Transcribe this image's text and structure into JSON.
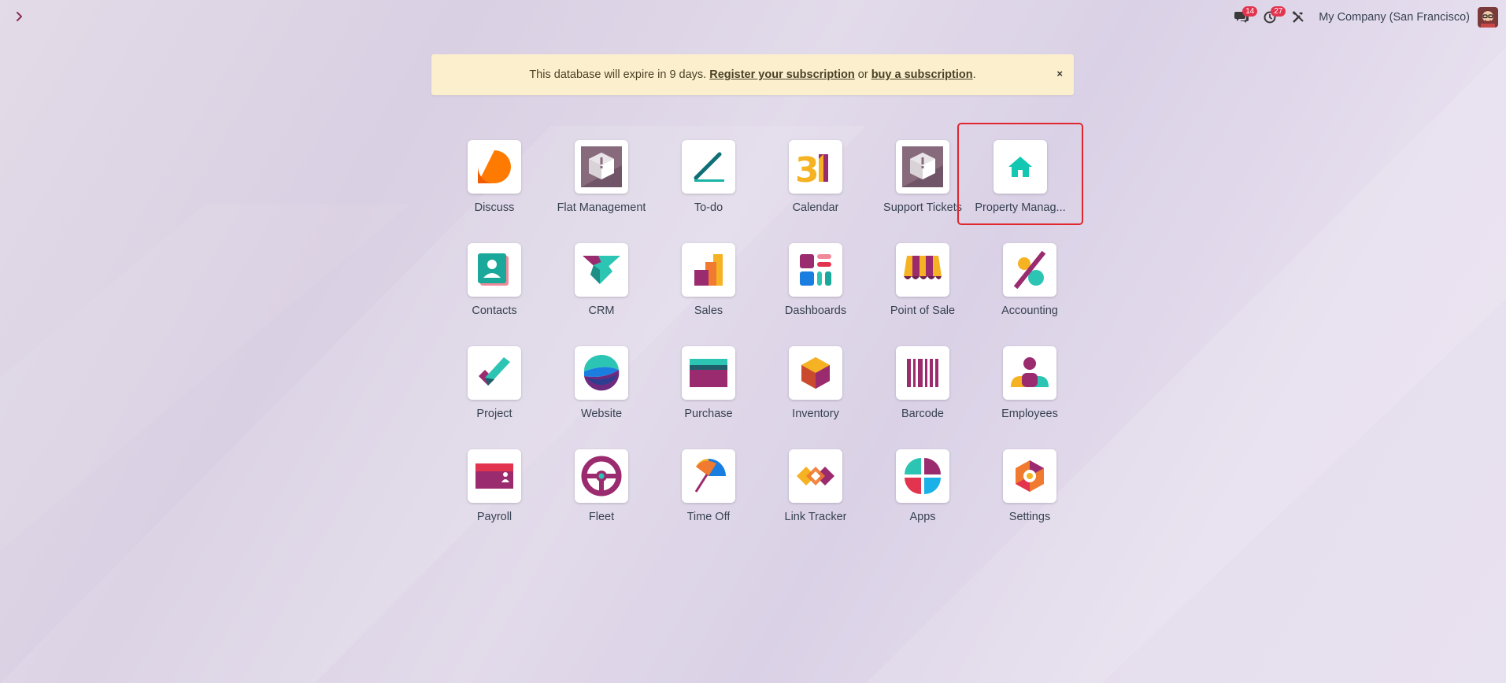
{
  "topbar": {
    "messages_badge": "14",
    "activities_badge": "27",
    "company_name": "My Company (San Francisco)"
  },
  "banner": {
    "text_before": "This database will expire in 9 days. ",
    "register_link": "Register your subscription",
    "text_middle": " or ",
    "buy_link": "buy a subscription",
    "text_after": ".",
    "close_label": "×"
  },
  "apps": [
    {
      "label": "Discuss",
      "icon": "discuss-icon"
    },
    {
      "label": "Flat Management",
      "icon": "flat-management-icon"
    },
    {
      "label": "To-do",
      "icon": "todo-icon"
    },
    {
      "label": "Calendar",
      "icon": "calendar-icon"
    },
    {
      "label": "Support Tickets",
      "icon": "support-tickets-icon"
    },
    {
      "label": "Property Manag...",
      "icon": "property-management-icon"
    },
    {
      "label": "Contacts",
      "icon": "contacts-icon"
    },
    {
      "label": "CRM",
      "icon": "crm-icon"
    },
    {
      "label": "Sales",
      "icon": "sales-icon"
    },
    {
      "label": "Dashboards",
      "icon": "dashboards-icon"
    },
    {
      "label": "Point of Sale",
      "icon": "point-of-sale-icon"
    },
    {
      "label": "Accounting",
      "icon": "accounting-icon"
    },
    {
      "label": "Project",
      "icon": "project-icon"
    },
    {
      "label": "Website",
      "icon": "website-icon"
    },
    {
      "label": "Purchase",
      "icon": "purchase-icon"
    },
    {
      "label": "Inventory",
      "icon": "inventory-icon"
    },
    {
      "label": "Barcode",
      "icon": "barcode-icon"
    },
    {
      "label": "Employees",
      "icon": "employees-icon"
    },
    {
      "label": "Payroll",
      "icon": "payroll-icon"
    },
    {
      "label": "Fleet",
      "icon": "fleet-icon"
    },
    {
      "label": "Time Off",
      "icon": "time-off-icon"
    },
    {
      "label": "Link Tracker",
      "icon": "link-tracker-icon"
    },
    {
      "label": "Apps",
      "icon": "apps-icon"
    },
    {
      "label": "Settings",
      "icon": "settings-icon"
    }
  ],
  "colors": {
    "selection_outline": "#e0262e",
    "badge": "#e3344f",
    "banner_bg": "#fbefcd"
  }
}
